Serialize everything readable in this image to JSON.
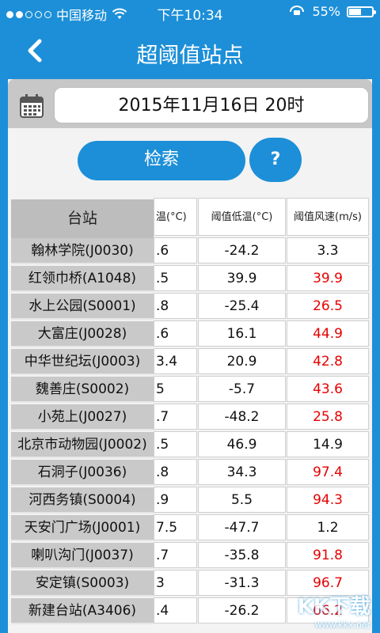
{
  "status_bar": {
    "carrier": "中国移动",
    "time": "下午10:34",
    "battery": "55%",
    "battery_level": 0.55
  },
  "nav": {
    "title": "超阈值站点"
  },
  "query": {
    "datetime": "2015年11月16日 20时",
    "search_label": "检索",
    "help_label": "?"
  },
  "table": {
    "headers": {
      "station": "台站",
      "high_temp": "温(°C)",
      "low_temp": "阈值低温(°C)",
      "wind": "阈值风速(m/s)"
    },
    "rows": [
      {
        "station": "翰林学院(J0030)",
        "high": ".6",
        "low": "-24.2",
        "wind": "3.3",
        "wind_alert": false
      },
      {
        "station": "红领巾桥(A1048)",
        "high": ".5",
        "low": "39.9",
        "wind": "39.9",
        "wind_alert": true
      },
      {
        "station": "水上公园(S0001)",
        "high": ".8",
        "low": "-25.4",
        "wind": "26.5",
        "wind_alert": true
      },
      {
        "station": "大富庄(J0028)",
        "high": ".6",
        "low": "16.1",
        "wind": "44.9",
        "wind_alert": true
      },
      {
        "station": "中华世纪坛(J0003)",
        "high": "3.4",
        "low": "20.9",
        "wind": "42.8",
        "wind_alert": true
      },
      {
        "station": "魏善庄(S0002)",
        "high": "5",
        "low": "-5.7",
        "wind": "43.6",
        "wind_alert": true
      },
      {
        "station": "小苑上(J0027)",
        "high": ".7",
        "low": "-48.2",
        "wind": "25.8",
        "wind_alert": true
      },
      {
        "station": "北京市动物园(J0002)",
        "high": ".5",
        "low": "46.9",
        "wind": "14.9",
        "wind_alert": false
      },
      {
        "station": "石洞子(J0036)",
        "high": ".8",
        "low": "34.3",
        "wind": "97.4",
        "wind_alert": true
      },
      {
        "station": "河西务镇(S0004)",
        "high": ".9",
        "low": "5.5",
        "wind": "94.3",
        "wind_alert": true
      },
      {
        "station": "天安门广场(J0001)",
        "high": "7.5",
        "low": "-47.7",
        "wind": "1.2",
        "wind_alert": false
      },
      {
        "station": "喇叭沟门(J0037)",
        "high": ".7",
        "low": "-35.8",
        "wind": "91.8",
        "wind_alert": true
      },
      {
        "station": "安定镇(S0003)",
        "high": "3",
        "low": "-31.3",
        "wind": "96.7",
        "wind_alert": true
      },
      {
        "station": "新建台站(A3406)",
        "high": ".4",
        "low": "-26.2",
        "wind": "66.2",
        "wind_alert": true
      }
    ]
  },
  "watermark": {
    "brand": "KK下载",
    "site": "www.kkx.net"
  },
  "colors": {
    "primary": "#1d8fd8",
    "alert": "#e60000"
  }
}
